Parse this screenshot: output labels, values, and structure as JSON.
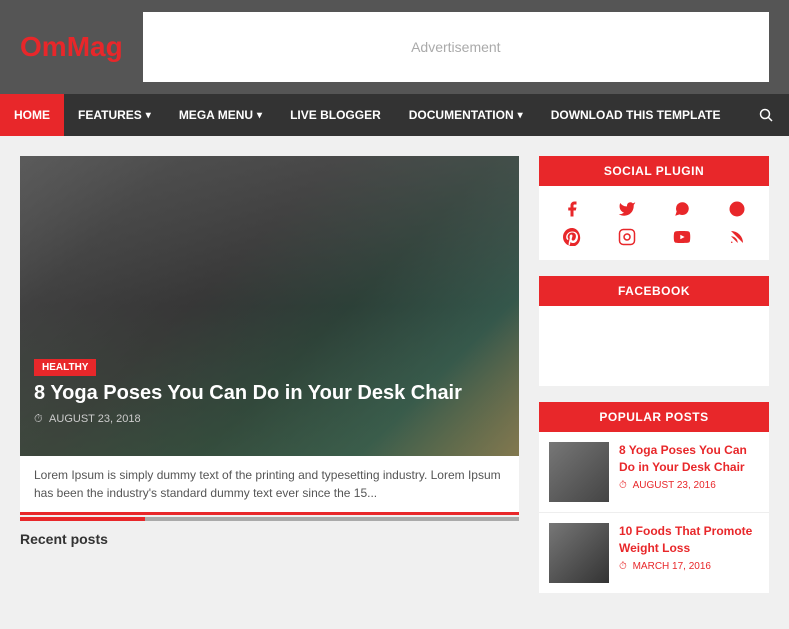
{
  "header": {
    "logo_text_black": "Om",
    "logo_text_red": "Mag",
    "ad_text": "Advertisement"
  },
  "nav": {
    "items": [
      {
        "label": "HOME",
        "active": true,
        "has_dropdown": false
      },
      {
        "label": "FEATURES",
        "active": false,
        "has_dropdown": true
      },
      {
        "label": "MEGA MENU",
        "active": false,
        "has_dropdown": true
      },
      {
        "label": "LIVE BLOGGER",
        "active": false,
        "has_dropdown": false
      },
      {
        "label": "DOCUMENTATION",
        "active": false,
        "has_dropdown": true
      },
      {
        "label": "DOWNLOAD THIS TEMPLATE",
        "active": false,
        "has_dropdown": false
      }
    ]
  },
  "hero": {
    "category": "HEALTHY",
    "title": "8 Yoga Poses You Can Do in Your Desk Chair",
    "date": "AUGUST 23, 2018",
    "excerpt": "Lorem Ipsum is simply dummy text of the printing and typesetting industry. Lorem Ipsum has been the industry's standard dummy text ever since the 15..."
  },
  "recent_posts_label": "Recent posts",
  "sidebar": {
    "social_plugin_title": "SOCIAL PLUGIN",
    "facebook_title": "FACEBOOK",
    "popular_posts_title": "POPULAR POSTS",
    "social_icons": [
      {
        "name": "facebook",
        "symbol": "f"
      },
      {
        "name": "twitter",
        "symbol": "t"
      },
      {
        "name": "whatsapp",
        "symbol": "w"
      },
      {
        "name": "reddit",
        "symbol": "r"
      },
      {
        "name": "pinterest",
        "symbol": "p"
      },
      {
        "name": "instagram",
        "symbol": "i"
      },
      {
        "name": "youtube",
        "symbol": "y"
      },
      {
        "name": "rss",
        "symbol": "s"
      }
    ],
    "popular_posts": [
      {
        "title": "8 Yoga Poses You Can Do in Your Desk Chair",
        "date": "AUGUST 23, 2016",
        "thumb_type": "dark"
      },
      {
        "title": "10 Foods That Promote Weight Loss",
        "date": "MARCH 17, 2016",
        "thumb_type": "alt"
      }
    ]
  }
}
